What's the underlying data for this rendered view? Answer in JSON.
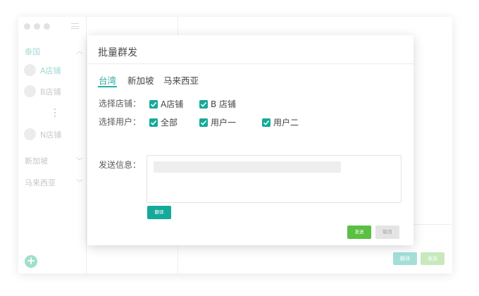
{
  "sidebar": {
    "regions": [
      {
        "label": "泰国",
        "active": true,
        "expanded": true
      },
      {
        "label": "新加坡",
        "active": false,
        "expanded": false
      },
      {
        "label": "马来西亚",
        "active": false,
        "expanded": false
      }
    ],
    "stores": [
      {
        "label": "A店铺",
        "active": true
      },
      {
        "label": "B店铺",
        "active": false
      },
      {
        "label": "N店铺",
        "active": false
      }
    ],
    "add_label": "+"
  },
  "background": {
    "translate_label": "翻译",
    "send_label": "发送"
  },
  "modal": {
    "title": "批量群发",
    "tabs": [
      {
        "label": "台湾",
        "active": true
      },
      {
        "label": "新加坡",
        "active": false
      },
      {
        "label": "马来西亚",
        "active": false
      }
    ],
    "store_row": {
      "label": "选择店铺：",
      "options": [
        {
          "label": "A店铺",
          "checked": true
        },
        {
          "label": "B 店铺",
          "checked": true
        }
      ]
    },
    "user_row": {
      "label": "选择用户：",
      "options": [
        {
          "label": "全部",
          "checked": true
        },
        {
          "label": "用户一",
          "checked": true
        },
        {
          "label": "用户二",
          "checked": true
        }
      ]
    },
    "message": {
      "label": "发送信息：",
      "value": ""
    },
    "translate_label": "翻译",
    "send_label": "发送",
    "cancel_label": "取消"
  },
  "colors": {
    "accent": "#16a99a",
    "send": "#5abf42"
  }
}
